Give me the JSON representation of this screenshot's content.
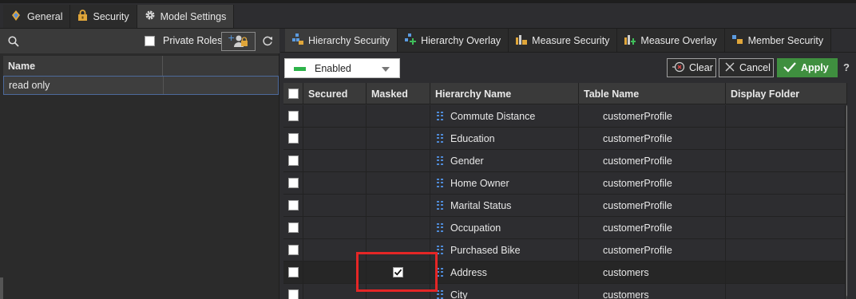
{
  "top_tabs": [
    {
      "label": "General",
      "icon": "general-icon",
      "active": false
    },
    {
      "label": "Security",
      "icon": "lock-icon",
      "active": false
    },
    {
      "label": "Model Settings",
      "icon": "gear-icon",
      "active": true
    }
  ],
  "left": {
    "private_roles_label": "Private Roles",
    "column_name": "Name",
    "roles": [
      "read only"
    ]
  },
  "sub_tabs": [
    {
      "label": "Hierarchy Security",
      "icon": "hierarchy-security-icon",
      "active": true
    },
    {
      "label": "Hierarchy Overlay",
      "icon": "hierarchy-overlay-icon",
      "active": false
    },
    {
      "label": "Measure Security",
      "icon": "measure-security-icon",
      "active": false
    },
    {
      "label": "Measure Overlay",
      "icon": "measure-overlay-icon",
      "active": false
    },
    {
      "label": "Member Security",
      "icon": "member-security-icon",
      "active": false
    }
  ],
  "toolbar": {
    "enabled_value": "Enabled",
    "clear_label": "Clear",
    "cancel_label": "Cancel",
    "apply_label": "Apply",
    "help_label": "?",
    "enabled_color": "#2db34a",
    "apply_color": "#3f8f3f"
  },
  "grid": {
    "columns": [
      "Secured",
      "Masked",
      "Hierarchy Name",
      "Table Name",
      "Display Folder"
    ],
    "rows": [
      {
        "hierarchy": "Commute Distance",
        "table": "customerProfile",
        "masked": false
      },
      {
        "hierarchy": "Education",
        "table": "customerProfile",
        "masked": false
      },
      {
        "hierarchy": "Gender",
        "table": "customerProfile",
        "masked": false
      },
      {
        "hierarchy": "Home Owner",
        "table": "customerProfile",
        "masked": false
      },
      {
        "hierarchy": "Marital Status",
        "table": "customerProfile",
        "masked": false
      },
      {
        "hierarchy": "Occupation",
        "table": "customerProfile",
        "masked": false
      },
      {
        "hierarchy": "Purchased Bike",
        "table": "customerProfile",
        "masked": false
      },
      {
        "hierarchy": "Address",
        "table": "customers",
        "masked": true
      },
      {
        "hierarchy": "City",
        "table": "customers",
        "masked": false
      }
    ]
  },
  "highlight_color": "#e52626"
}
